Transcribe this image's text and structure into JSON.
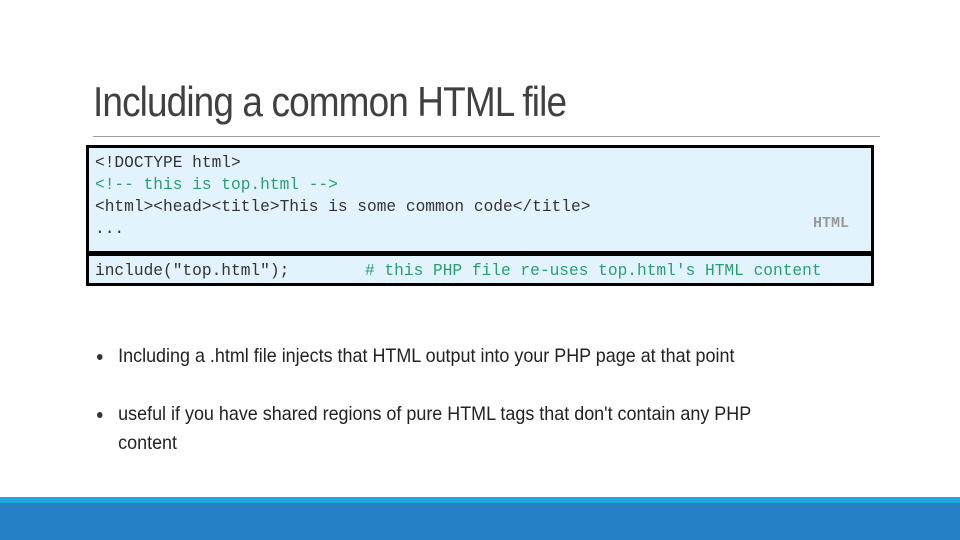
{
  "slide": {
    "title": "Including a common HTML file",
    "html_code": {
      "lines": [
        "<!DOCTYPE html>",
        "<!-- this is top.html -->",
        "<html><head><title>This is some common code</title>",
        "..."
      ],
      "language_label": "HTML"
    },
    "php_code": {
      "code": "include(\"top.html\");",
      "comment": "# this PHP file re-uses top.html's HTML content"
    },
    "bullets": [
      "Including a .html file injects that HTML output into your PHP page at that point",
      "useful if you have shared regions of pure HTML tags that don't contain any PHP content"
    ]
  },
  "colors": {
    "code_background": "#e3f3fd",
    "comment": "#2a9d72",
    "footer_bar": "#2581c4",
    "footer_strip": "#22a8dc"
  }
}
